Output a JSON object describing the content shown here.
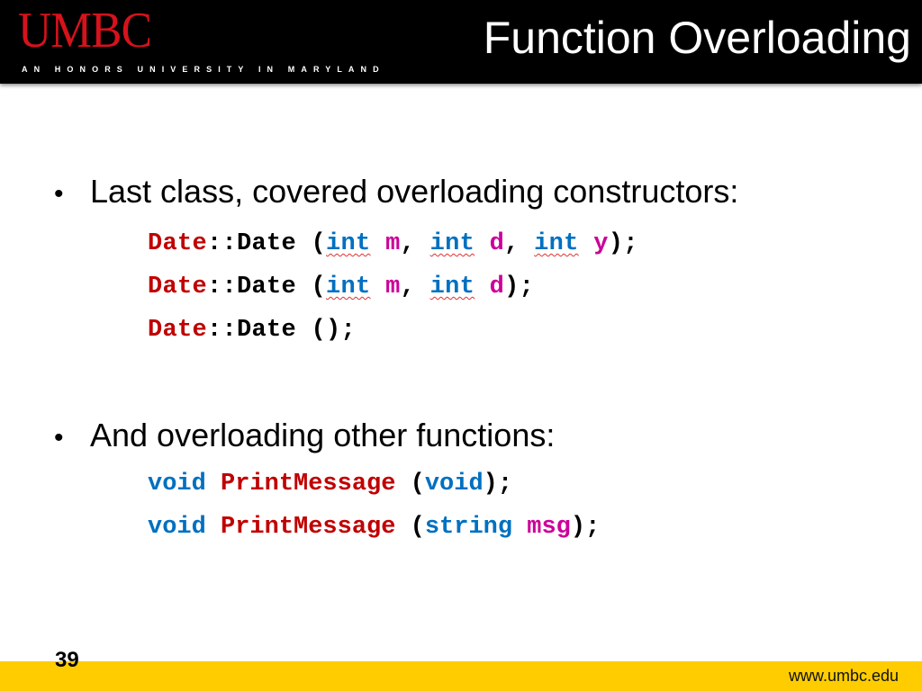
{
  "header": {
    "logo": "UMBC",
    "tagline": "AN HONORS UNIVERSITY IN MARYLAND",
    "title": "Function Overloading"
  },
  "colors": {
    "header_bg": "#000000",
    "logo_red": "#d6121b",
    "footer_gold": "#ffcc00",
    "code_red": "#c00000",
    "code_blue": "#0070c0",
    "code_magenta": "#cc0099"
  },
  "bullets": [
    {
      "icon": "bullet-dot",
      "text": "Last class, covered overloading constructors:",
      "code": [
        [
          {
            "t": "Date",
            "c": "red"
          },
          {
            "t": "::Date (",
            "c": "black"
          },
          {
            "t": "int",
            "c": "blue",
            "sq": true
          },
          {
            "t": " ",
            "c": "black"
          },
          {
            "t": "m",
            "c": "magenta"
          },
          {
            "t": ", ",
            "c": "black"
          },
          {
            "t": "int",
            "c": "blue",
            "sq": true
          },
          {
            "t": " ",
            "c": "black"
          },
          {
            "t": "d",
            "c": "magenta"
          },
          {
            "t": ", ",
            "c": "black"
          },
          {
            "t": "int",
            "c": "blue",
            "sq": true
          },
          {
            "t": " ",
            "c": "black"
          },
          {
            "t": "y",
            "c": "magenta"
          },
          {
            "t": ");",
            "c": "black"
          }
        ],
        [
          {
            "t": "Date",
            "c": "red"
          },
          {
            "t": "::Date (",
            "c": "black"
          },
          {
            "t": "int",
            "c": "blue",
            "sq": true
          },
          {
            "t": " ",
            "c": "black"
          },
          {
            "t": "m",
            "c": "magenta"
          },
          {
            "t": ", ",
            "c": "black"
          },
          {
            "t": "int",
            "c": "blue",
            "sq": true
          },
          {
            "t": " ",
            "c": "black"
          },
          {
            "t": "d",
            "c": "magenta"
          },
          {
            "t": ");",
            "c": "black"
          }
        ],
        [
          {
            "t": "Date",
            "c": "red"
          },
          {
            "t": "::Date ();",
            "c": "black"
          }
        ]
      ]
    },
    {
      "icon": "bullet-dot",
      "text": "And overloading other functions:",
      "code": [
        [
          {
            "t": "void",
            "c": "blue"
          },
          {
            "t": " ",
            "c": "black"
          },
          {
            "t": "PrintMessage",
            "c": "red"
          },
          {
            "t": " (",
            "c": "black"
          },
          {
            "t": "void",
            "c": "blue"
          },
          {
            "t": ");",
            "c": "black"
          }
        ],
        [
          {
            "t": "void",
            "c": "blue"
          },
          {
            "t": " ",
            "c": "black"
          },
          {
            "t": "PrintMessage",
            "c": "red"
          },
          {
            "t": " (",
            "c": "black"
          },
          {
            "t": "string",
            "c": "blue"
          },
          {
            "t": " ",
            "c": "black"
          },
          {
            "t": "msg",
            "c": "magenta"
          },
          {
            "t": ");",
            "c": "black"
          }
        ]
      ]
    }
  ],
  "footer": {
    "page_number": "39",
    "url": "www.umbc.edu"
  }
}
